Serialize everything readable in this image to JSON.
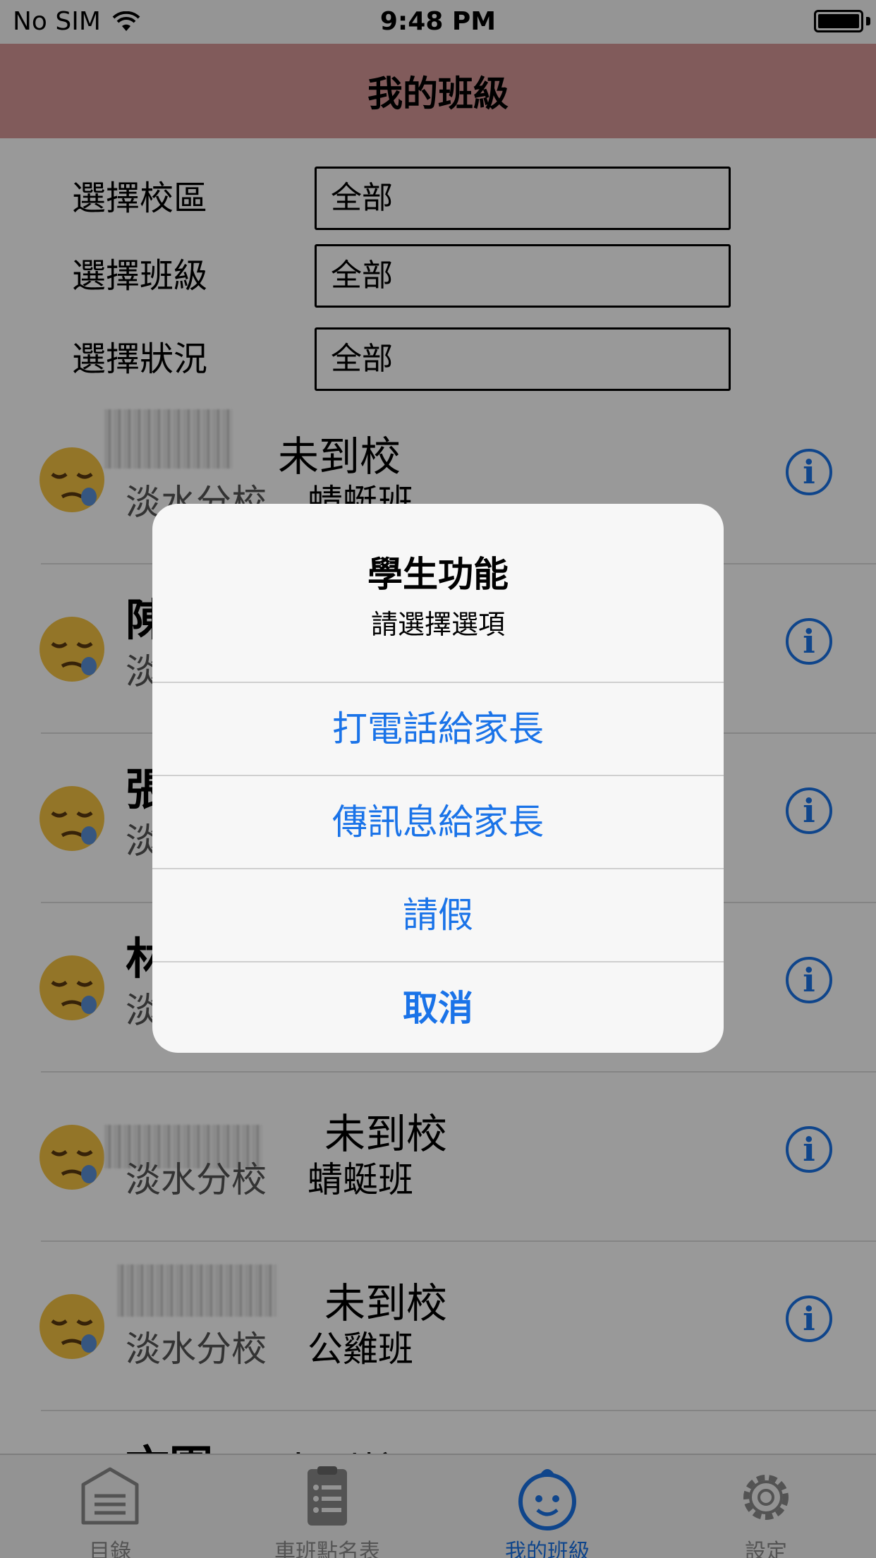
{
  "status_bar": {
    "carrier": "No SIM",
    "time": "9:48 PM"
  },
  "nav": {
    "title": "我的班級"
  },
  "filters": [
    {
      "label": "選擇校區",
      "value": "全部"
    },
    {
      "label": "選擇班級",
      "value": "全部"
    },
    {
      "label": "選擇狀況",
      "value": "全部"
    }
  ],
  "students": [
    {
      "name": "",
      "status": "未到校",
      "campus": "淡水分校",
      "class": "蜻蜓班"
    },
    {
      "name": "陳",
      "status": "",
      "campus": "淡",
      "class": ""
    },
    {
      "name": "張",
      "status": "",
      "campus": "淡",
      "class": ""
    },
    {
      "name": "林",
      "status": "",
      "campus": "淡",
      "class": ""
    },
    {
      "name": "",
      "status": "未到校",
      "campus": "淡水分校",
      "class": "蜻蜓班"
    },
    {
      "name": "",
      "status": "未到校",
      "campus": "淡水分校",
      "class": "公雞班"
    },
    {
      "name": "文園",
      "status": "未到校",
      "campus": "",
      "class": ""
    }
  ],
  "tabs": [
    {
      "label": "目錄",
      "icon": "catalog-icon"
    },
    {
      "label": "車班點名表",
      "icon": "clipboard-icon"
    },
    {
      "label": "我的班級",
      "icon": "baby-face-icon"
    },
    {
      "label": "設定",
      "icon": "gear-icon"
    }
  ],
  "alert": {
    "title": "學生功能",
    "message": "請選擇選項",
    "buttons": {
      "call_parent": "打電話給家長",
      "message_parent": "傳訊息給家長",
      "leave": "請假",
      "cancel": "取消"
    }
  },
  "colors": {
    "nav_bar": "#d79898",
    "accent": "#1a73e8"
  }
}
